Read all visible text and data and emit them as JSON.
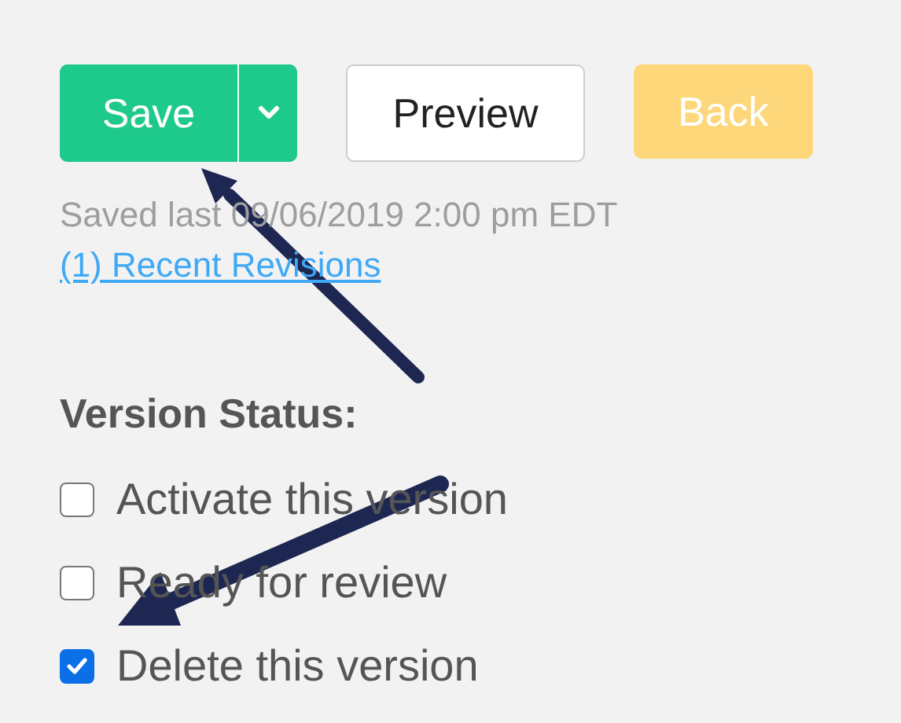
{
  "buttons": {
    "save": "Save",
    "preview": "Preview",
    "back": "Back"
  },
  "saved_text": "Saved last 09/06/2019 2:00 pm EDT",
  "revisions_link": "(1) Recent Revisions",
  "version_status": {
    "heading": "Version Status:",
    "options": [
      {
        "label": "Activate this version",
        "checked": false
      },
      {
        "label": "Ready for review",
        "checked": false
      },
      {
        "label": "Delete this version",
        "checked": true
      }
    ]
  }
}
